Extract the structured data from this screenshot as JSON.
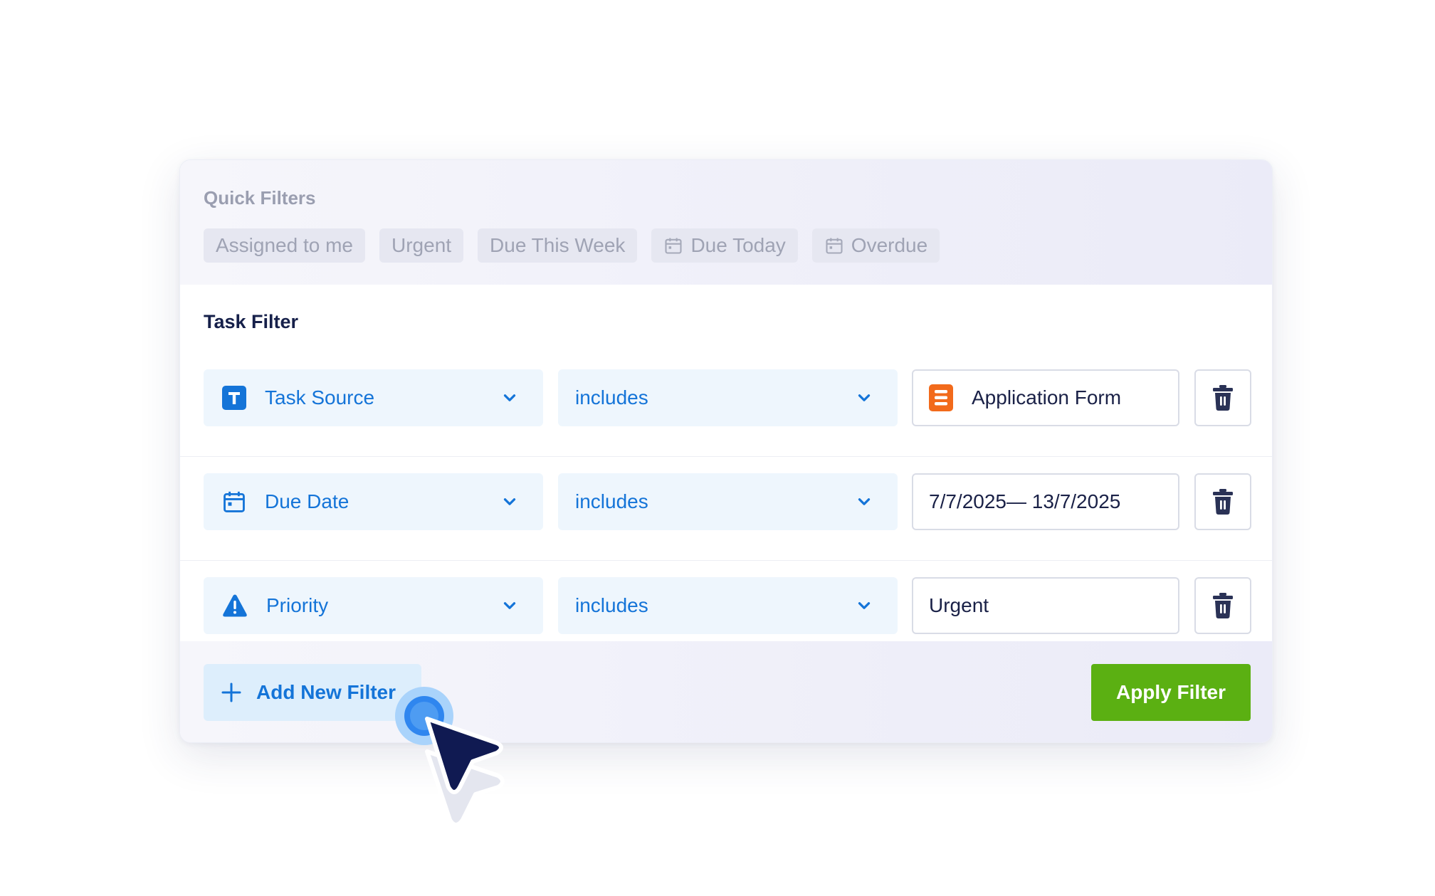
{
  "quick_filters": {
    "title": "Quick Filters",
    "chips": [
      {
        "label": "Assigned to me",
        "icon": ""
      },
      {
        "label": "Urgent",
        "icon": ""
      },
      {
        "label": "Due This Week",
        "icon": ""
      },
      {
        "label": "Due Today",
        "icon": "calendar-icon"
      },
      {
        "label": "Overdue",
        "icon": "calendar-icon"
      }
    ]
  },
  "task_filter": {
    "title": "Task Filter",
    "rows": [
      {
        "field": "Task Source",
        "field_icon": "text-field-icon",
        "operator": "includes",
        "value": "Application Form",
        "value_icon": "form-icon"
      },
      {
        "field": "Due Date",
        "field_icon": "calendar-icon",
        "operator": "includes",
        "value": "7/7/2025— 13/7/2025"
      },
      {
        "field": "Priority",
        "field_icon": "warning-icon",
        "operator": "includes",
        "value": "Urgent"
      }
    ]
  },
  "footer": {
    "add_label": "Add New Filter",
    "apply_label": "Apply Filter"
  },
  "colors": {
    "accent": "#1474d8",
    "apply": "#5bb012",
    "form_icon": "#f26a1b",
    "text_dark": "#1a2147"
  }
}
